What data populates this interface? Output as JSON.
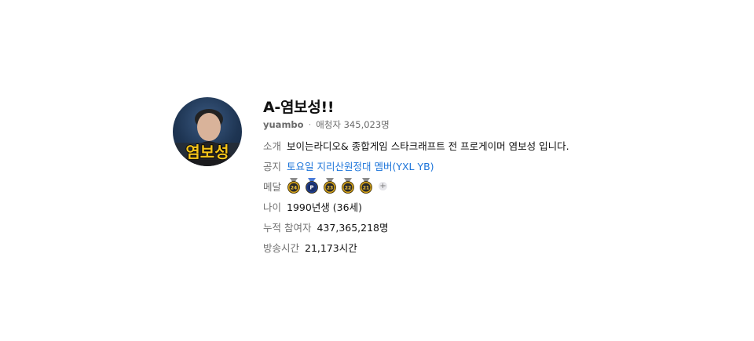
{
  "profile": {
    "name": "A-염보성!!",
    "handle": "yuambo",
    "separator": "·",
    "fans_label": "애청자 345,023명",
    "avatar_text": "염보성"
  },
  "rows": {
    "intro": {
      "label": "소개",
      "value": "보이는라디오& 종합게임 스타크래프트 전 프로게이머 염보성 입니다."
    },
    "notice": {
      "label": "공지",
      "value": "토요일 지리산원정대 멤버(YXL YB)"
    },
    "medals": {
      "label": "메달",
      "items": [
        {
          "text": "24",
          "type": "gold",
          "icon": "medal-icon"
        },
        {
          "text": "P",
          "type": "blue",
          "icon": "medal-icon"
        },
        {
          "text": "23",
          "type": "gold",
          "icon": "medal-icon"
        },
        {
          "text": "22",
          "type": "gold",
          "icon": "medal-icon"
        },
        {
          "text": "21",
          "type": "gold",
          "icon": "medal-icon"
        }
      ],
      "more": "+"
    },
    "age": {
      "label": "나이",
      "value": "1990년생 (36세)"
    },
    "viewers": {
      "label": "누적 참여자",
      "value": "437,365,218명"
    },
    "hours": {
      "label": "방송시간",
      "value": "21,173시간"
    }
  },
  "colors": {
    "link": "#1a73d9",
    "label": "#707070",
    "medal_gold": "#d4a21a",
    "medal_blue": "#1f3f8f"
  }
}
